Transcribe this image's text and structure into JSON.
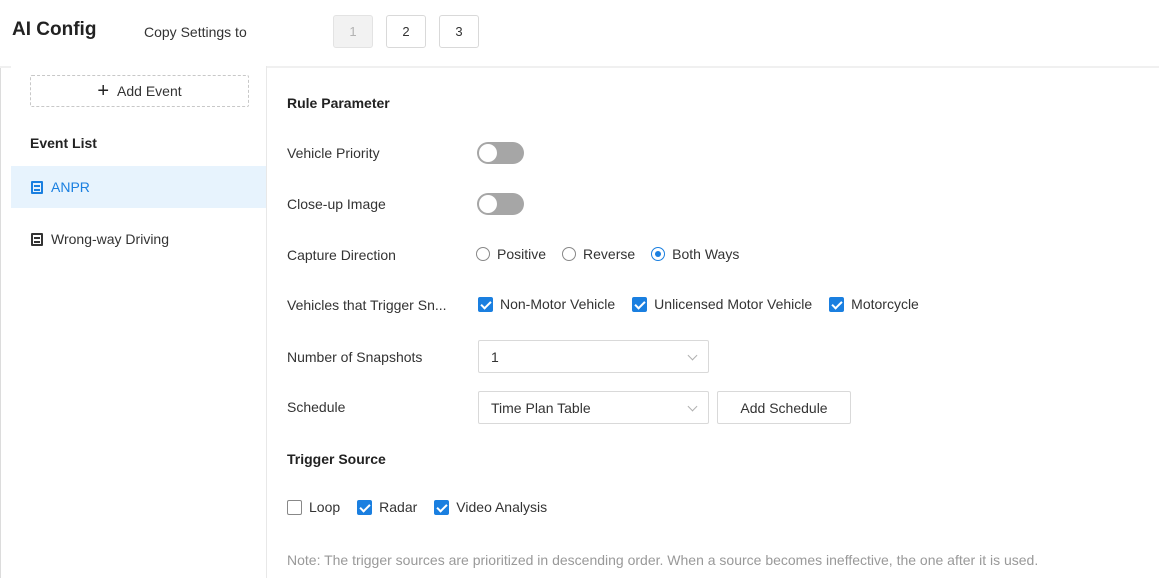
{
  "header": {
    "title": "AI Config",
    "copy_settings_label": "Copy Settings to",
    "channels": [
      "1",
      "2",
      "3"
    ]
  },
  "sidebar": {
    "add_event_label": "Add Event",
    "event_list_title": "Event List",
    "events": [
      {
        "label": "ANPR",
        "active": true,
        "icon": "document-icon"
      },
      {
        "label": "Wrong-way Driving",
        "active": false,
        "icon": "document-icon"
      }
    ]
  },
  "rule": {
    "title": "Rule Parameter",
    "vehicle_priority_label": "Vehicle Priority",
    "vehicle_priority_on": false,
    "closeup_label": "Close-up Image",
    "closeup_on": false,
    "capture_direction_label": "Capture Direction",
    "capture_directions": [
      {
        "label": "Positive",
        "checked": false
      },
      {
        "label": "Reverse",
        "checked": false
      },
      {
        "label": "Both Ways",
        "checked": true
      }
    ],
    "trigger_vehicles_label": "Vehicles that Trigger Sn...",
    "trigger_vehicles": [
      {
        "label": "Non-Motor Vehicle",
        "checked": true
      },
      {
        "label": "Unlicensed Motor Vehicle",
        "checked": true
      },
      {
        "label": "Motorcycle",
        "checked": true
      }
    ],
    "snapshots_label": "Number of Snapshots",
    "snapshots_value": "1",
    "schedule_label": "Schedule",
    "schedule_value": "Time Plan Table",
    "add_schedule_label": "Add Schedule"
  },
  "trigger": {
    "title": "Trigger Source",
    "sources": [
      {
        "label": "Loop",
        "checked": false
      },
      {
        "label": "Radar",
        "checked": true
      },
      {
        "label": "Video Analysis",
        "checked": true
      }
    ],
    "note": "Note: The trigger sources are prioritized in descending order. When a source becomes ineffective, the one after it is used."
  },
  "colors": {
    "accent": "#1a7fe0",
    "active_bg": "#e7f3fd",
    "toggle_off": "#a6a6a6"
  }
}
